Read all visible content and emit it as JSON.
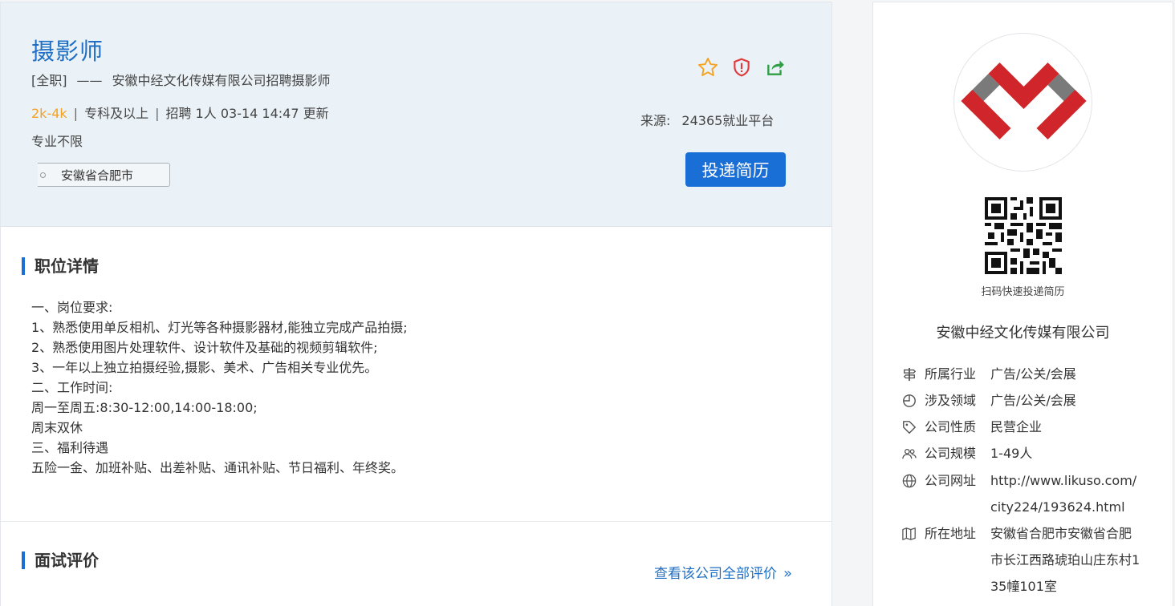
{
  "job": {
    "title": "摄影师",
    "type": "[全职]",
    "dash": "——",
    "headline": "安徽中经文化传媒有限公司招聘摄影师",
    "salary": "2k-4k",
    "sep": "|",
    "education": "专科及以上",
    "openings": "招聘 1人",
    "updated": "03-14 14:47 更新",
    "major": "专业不限",
    "location": "安徽省合肥市"
  },
  "actions": {
    "favorite_icon": "star-outline-icon",
    "report_icon": "shield-alert-icon",
    "share_icon": "share-icon"
  },
  "source": {
    "label": "来源:",
    "value": "24365就业平台"
  },
  "apply_button": "投递简历",
  "sections": {
    "details_title": "职位详情",
    "details_lines": [
      "一、岗位要求:",
      "1、熟悉使用单反相机、灯光等各种摄影器材,能独立完成产品拍摄;",
      "2、熟悉使用图片处理软件、设计软件及基础的视频剪辑软件;",
      "3、一年以上独立拍摄经验,摄影、美术、广告相关专业优先。",
      "二、工作时间:",
      "周一至周五:8:30-12:00,14:00-18:00;",
      "周末双休",
      "三、福利待遇",
      "五险一金、加班补贴、出差补贴、通讯补贴、节日福利、年终奖。"
    ],
    "review_title": "面试评价",
    "view_all": "查看该公司全部评价",
    "view_all_chevron": "»"
  },
  "company": {
    "qr_caption": "扫码快速投递简历",
    "name": "安徽中经文化传媒有限公司",
    "info": [
      {
        "icon": "signpost-icon",
        "label": "所属行业",
        "value": "广告/公关/会展"
      },
      {
        "icon": "pie-chart-icon",
        "label": "涉及领域",
        "value": "广告/公关/会展"
      },
      {
        "icon": "tag-icon",
        "label": "公司性质",
        "value": "民营企业"
      },
      {
        "icon": "people-icon",
        "label": "公司规模",
        "value": "1-49人"
      },
      {
        "icon": "globe-icon",
        "label": "公司网址",
        "value": "http://www.likuso.com/city224/193624.html"
      },
      {
        "icon": "map-icon",
        "label": "所在地址",
        "value": "安徽省合肥市安徽省合肥市长江西路琥珀山庄东村135幢101室"
      }
    ]
  },
  "colors": {
    "accent": "#1a6fd6",
    "title_blue": "#1f6fc4",
    "salary_orange": "#f5a122",
    "logo_red": "#d0262b",
    "logo_gray": "#7a7a7a"
  }
}
